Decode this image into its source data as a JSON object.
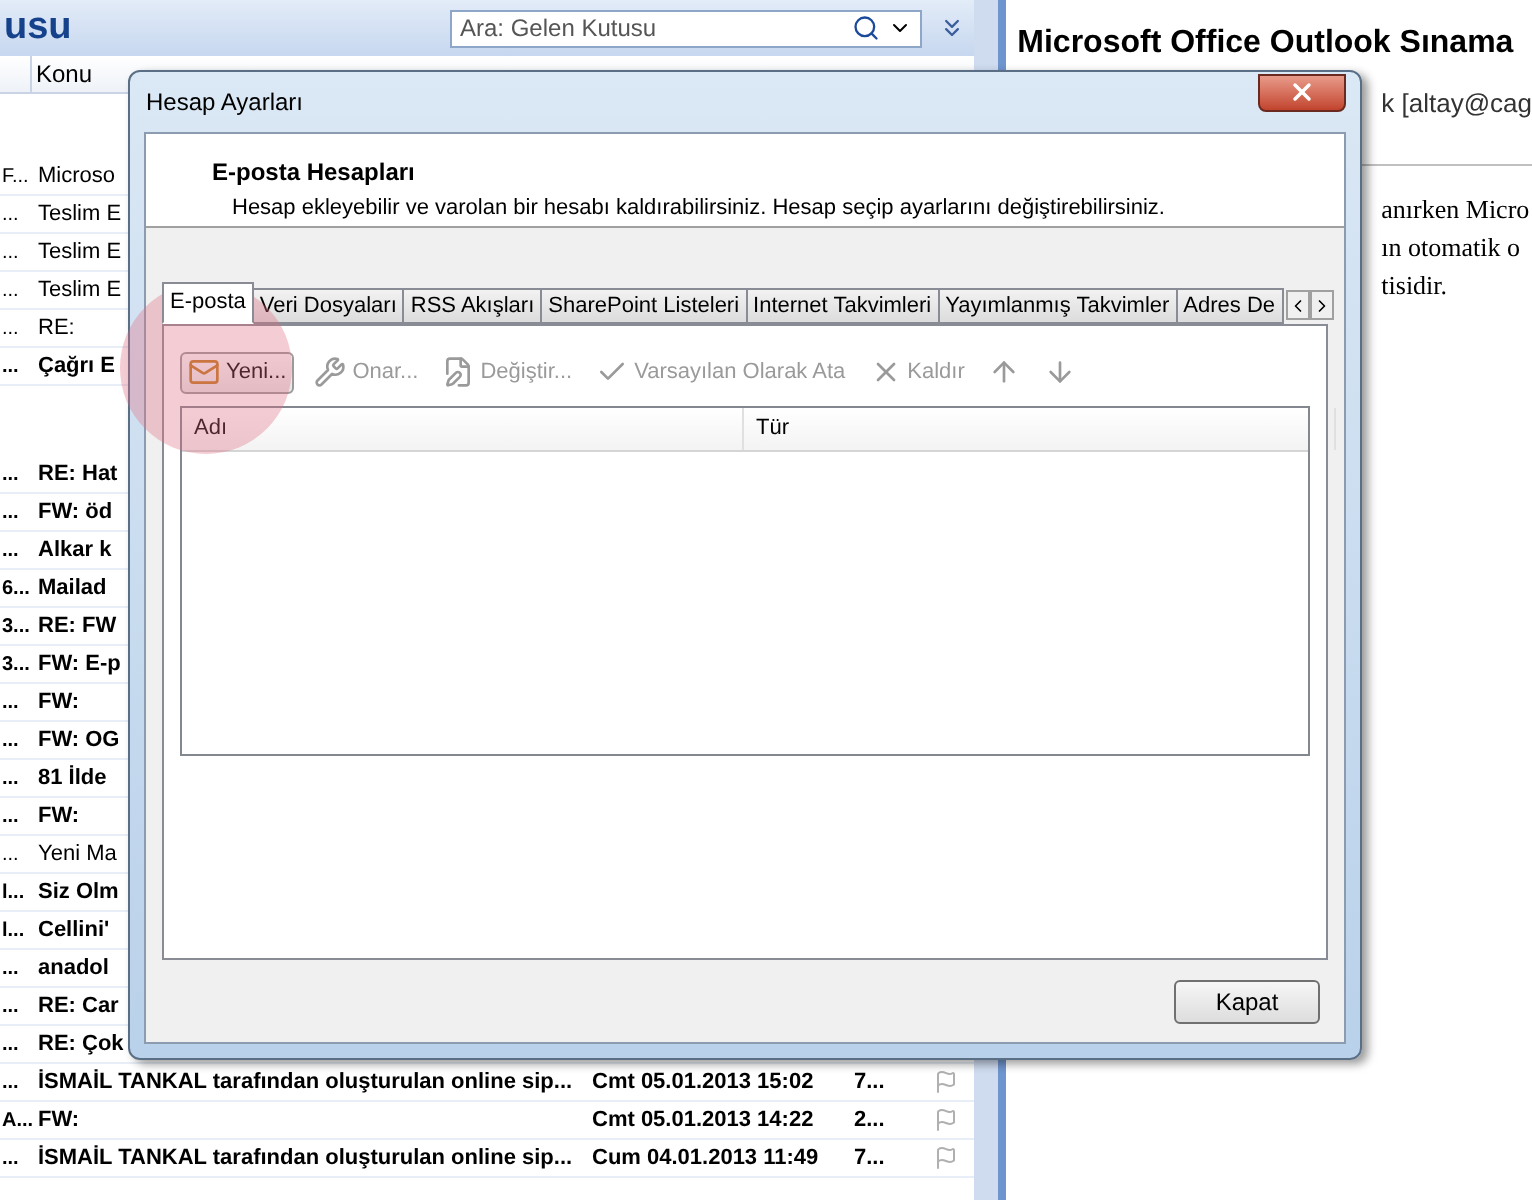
{
  "mail": {
    "folder_title": "usu",
    "search": {
      "placeholder": "Ara: Gelen Kutusu"
    },
    "columns": [
      "Konu"
    ],
    "groups": [
      {
        "messages": [
          {
            "col1": "F...",
            "subject": "Microso",
            "unread": false
          },
          {
            "col1": "...",
            "subject": "Teslim E",
            "unread": false
          },
          {
            "col1": "...",
            "subject": "Teslim E",
            "unread": false
          },
          {
            "col1": "...",
            "subject": "Teslim E",
            "unread": false
          },
          {
            "col1": "...",
            "subject": "RE:",
            "unread": false
          },
          {
            "col1": "...",
            "subject": "Çağrı E",
            "unread": true
          }
        ]
      },
      {
        "messages": [
          {
            "col1": "...",
            "subject": "RE: Hat",
            "unread": true
          },
          {
            "col1": "...",
            "subject": "FW: öd",
            "unread": true
          },
          {
            "col1": "...",
            "subject": "Alkar k",
            "unread": true
          },
          {
            "col1": "6...",
            "subject": "Mailad",
            "unread": true
          },
          {
            "col1": "3...",
            "subject": "RE: FW",
            "unread": true
          },
          {
            "col1": "3...",
            "subject": "FW: E-p",
            "unread": true
          },
          {
            "col1": "...",
            "subject": "FW:",
            "unread": true
          },
          {
            "col1": "...",
            "subject": "FW: OG",
            "unread": true
          },
          {
            "col1": "...",
            "subject": "81 İlde",
            "unread": true
          },
          {
            "col1": "...",
            "subject": "FW:",
            "unread": true
          },
          {
            "col1": "...",
            "subject": "Yeni Ma",
            "unread": false
          },
          {
            "col1": "l...",
            "subject": "Siz Olm",
            "unread": true
          },
          {
            "col1": "l...",
            "subject": "Cellini'",
            "unread": true
          },
          {
            "col1": "...",
            "subject": "anadol",
            "unread": true
          },
          {
            "col1": "...",
            "subject": "RE: Car",
            "unread": true
          },
          {
            "col1": "...",
            "subject": "RE: Çok",
            "unread": true
          },
          {
            "col1": "...",
            "subject": "İSMAİL TANKAL tarafından oluşturulan online sip...",
            "date": "Cmt 05.01.2013 15:02",
            "size": "7...",
            "unread": true
          },
          {
            "col1": "A...",
            "subject": "FW:",
            "date": "Cmt 05.01.2013 14:22",
            "size": "2...",
            "unread": true
          },
          {
            "col1": "...",
            "subject": "İSMAİL TANKAL tarafından oluşturulan online sip...",
            "date": "Cum 04.01.2013 11:49",
            "size": "7...",
            "unread": true
          }
        ]
      }
    ]
  },
  "reading_pane": {
    "subject": "Microsoft Office Outlook Sınama",
    "from": "k [altay@cag",
    "body": [
      "anırken Micro",
      "ın otomatik o",
      "tisidir."
    ]
  },
  "dialog": {
    "title": "Hesap Ayarları",
    "heading": "E-posta Hesapları",
    "description": "Hesap ekleyebilir ve varolan bir hesabı kaldırabilirsiniz. Hesap seçip ayarlarını değiştirebilirsiniz.",
    "tabs": [
      {
        "label": "E-posta",
        "selected": true
      },
      {
        "label": "Veri Dosyaları",
        "selected": false
      },
      {
        "label": "RSS Akışları",
        "selected": false
      },
      {
        "label": "SharePoint Listeleri",
        "selected": false
      },
      {
        "label": "Internet Takvimleri",
        "selected": false
      },
      {
        "label": "Yayımlanmış Takvimler",
        "selected": false
      },
      {
        "label": "Adres De",
        "selected": false
      }
    ],
    "toolbar": [
      {
        "kind": "new",
        "label": "Yeni...",
        "disabled": false
      },
      {
        "kind": "repair",
        "label": "Onar...",
        "disabled": true
      },
      {
        "kind": "change",
        "label": "Değiştir...",
        "disabled": true
      },
      {
        "kind": "default",
        "label": "Varsayılan Olarak Ata",
        "disabled": true
      },
      {
        "kind": "remove",
        "label": "Kaldır",
        "disabled": true
      },
      {
        "kind": "up",
        "disabled": true
      },
      {
        "kind": "down",
        "disabled": true
      }
    ],
    "table": {
      "columns": [
        "Adı",
        "Tür"
      ]
    },
    "close_button": "Kapat"
  }
}
